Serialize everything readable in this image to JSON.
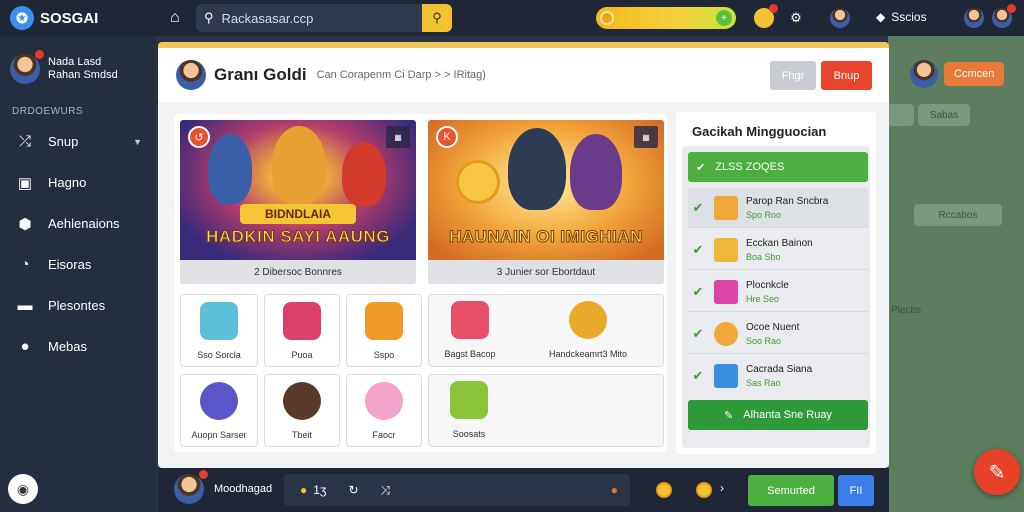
{
  "topbar": {
    "brand": "SOSGAI",
    "search_text": "Rackasasar.ccp",
    "user_label": "Sscios"
  },
  "sidebar": {
    "profile_name_1": "Nada Lasd",
    "profile_name_2": "Rahan Smdsd",
    "section": "DRDOEWURS",
    "items": [
      {
        "label": "Snup",
        "icon": "shuffle-icon",
        "chevron": true
      },
      {
        "label": "Hagno",
        "icon": "card-icon",
        "chevron": false
      },
      {
        "label": "Aehlenaions",
        "icon": "package-icon",
        "chevron": false
      },
      {
        "label": "Eisoras",
        "icon": "gauge-icon",
        "chevron": false
      },
      {
        "label": "Plesontes",
        "icon": "tag-icon",
        "chevron": false
      },
      {
        "label": "Mebas",
        "icon": "info-icon",
        "chevron": false
      }
    ]
  },
  "background": {
    "contact_button": "Ccmcen",
    "tile_1": "Sabas",
    "tile_2": "Rccabos",
    "tile_3": "Plecbs"
  },
  "dialog": {
    "title": "Granı Goldi",
    "subtitle": "Can Corapenm  Ci  Darp  >  > IRitag)",
    "btn_gray": "Fhgr",
    "btn_red": "Bnup",
    "games": [
      {
        "banner": "HADKIN SAYI AAUNG",
        "banner_top": "BIDNDLAIA",
        "caption": "2 Dibersoc Bonnres"
      },
      {
        "banner": "HAUNAIN OI IMIGHIAN",
        "banner_top": "",
        "caption": "3 Junier sor Ebortdaut"
      }
    ],
    "items": [
      {
        "label": "Sso Sorcla"
      },
      {
        "label": "Puoa"
      },
      {
        "label": "Sspo"
      },
      {
        "label": "Bagst Bacop"
      },
      {
        "label": "Handckeamrt3 Mito"
      },
      {
        "label": "Auopn Sarser"
      },
      {
        "label": "Tbeit"
      },
      {
        "label": "Faocr"
      },
      {
        "label": "Soosats"
      }
    ],
    "right": {
      "title": "Gacikah Mingguocian",
      "top_btn": "ZLSS ZOQES",
      "tasks": [
        {
          "title": "Parop Ran Sncbra",
          "sub": "Spo Roo"
        },
        {
          "title": "Ecckan Bainon",
          "sub": "Boa Sbo"
        },
        {
          "title": "Plocnkcle",
          "sub": "Hre Seo"
        },
        {
          "title": "Ocoe Nuent",
          "sub": "Soo Rao"
        },
        {
          "title": "Cacrada Siana",
          "sub": "Sas Rao"
        }
      ],
      "bottom_btn": "Alhanta Sne Ruay"
    }
  },
  "bottombar": {
    "user": "Moodhagad",
    "count": "1ʒ",
    "btn_green": "Semurted",
    "btn_blue": "FII"
  }
}
